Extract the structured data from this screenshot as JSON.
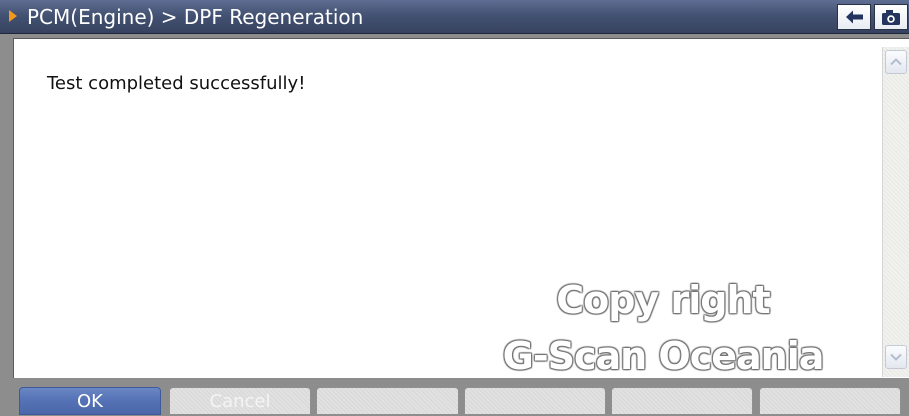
{
  "titlebar": {
    "path": "PCM(Engine) > DPF Regeneration",
    "arrow_color": "#f39a1e",
    "background": "#445273",
    "back_icon": "back-arrow-icon",
    "camera_icon": "camera-icon"
  },
  "content": {
    "message": "Test completed successfully!"
  },
  "watermark": {
    "line1": "Copy right",
    "line2": "G-Scan Oceania"
  },
  "scrollbar": {
    "up_icon": "chevron-up-icon",
    "down_icon": "chevron-down-icon"
  },
  "buttons": [
    {
      "label": "OK",
      "state": "active"
    },
    {
      "label": "Cancel",
      "state": "disabled"
    },
    {
      "label": "",
      "state": "disabled"
    },
    {
      "label": "",
      "state": "disabled"
    },
    {
      "label": "",
      "state": "disabled"
    },
    {
      "label": "",
      "state": "disabled"
    }
  ]
}
